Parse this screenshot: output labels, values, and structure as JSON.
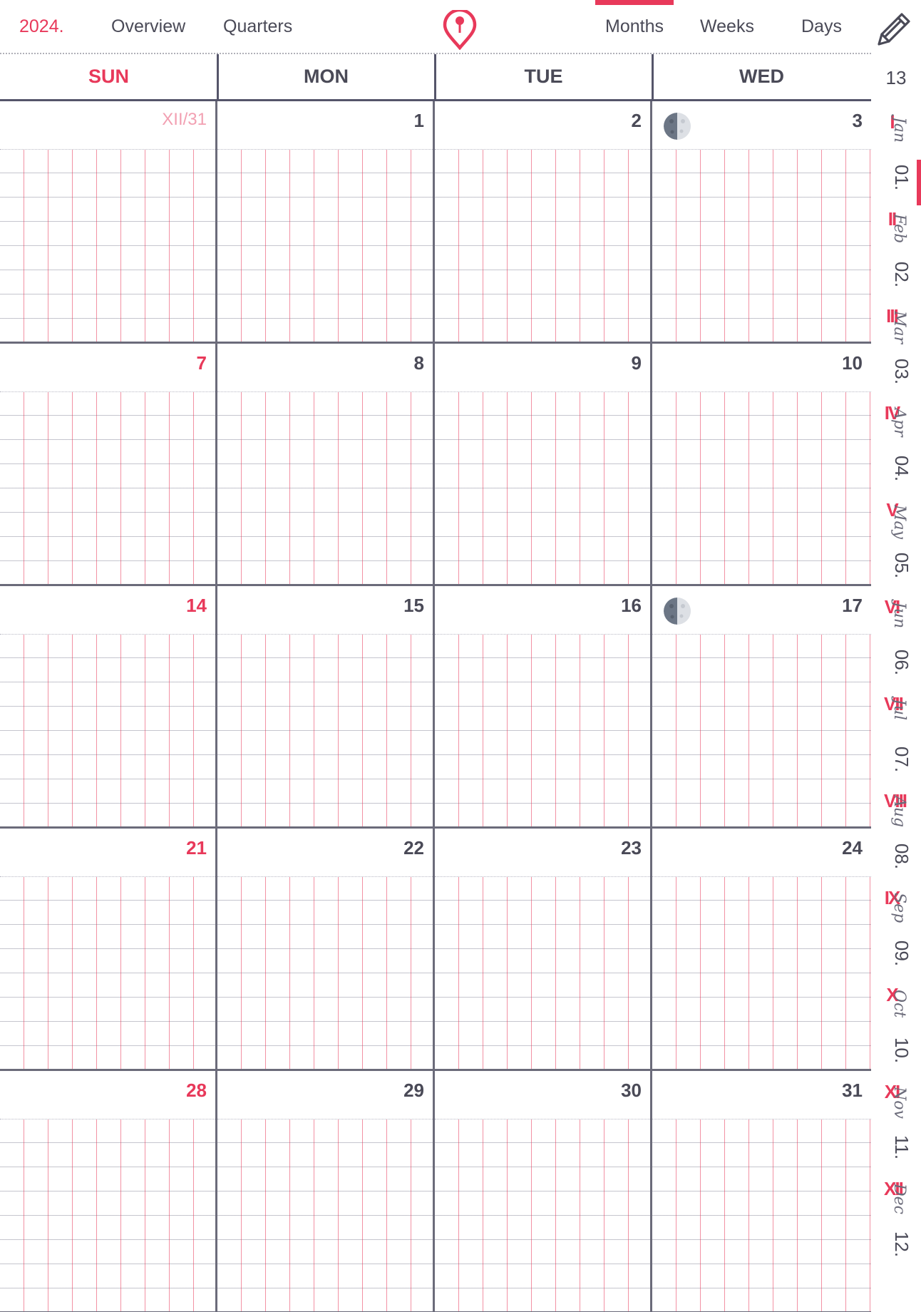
{
  "nav": {
    "year": "2024.",
    "overview": "Overview",
    "quarters": "Quarters",
    "months": "Months",
    "weeks": "Weeks",
    "days": "Days",
    "active_tab": "Months",
    "pin_icon": "location-pin-icon",
    "edit_icon": "pencil-icon"
  },
  "colors": {
    "accent": "#e8395a",
    "text": "#4a4a57",
    "grid": "#55556a"
  },
  "calendar": {
    "day_headers": [
      "SUN",
      "MON",
      "TUE",
      "WED"
    ],
    "weeks": [
      {
        "days": [
          {
            "label": "XII/31",
            "style": "prev"
          },
          {
            "label": "1"
          },
          {
            "label": "2"
          },
          {
            "label": "3",
            "moon": "last-quarter"
          }
        ]
      },
      {
        "days": [
          {
            "label": "7",
            "style": "sunday"
          },
          {
            "label": "8"
          },
          {
            "label": "9"
          },
          {
            "label": "10"
          }
        ]
      },
      {
        "days": [
          {
            "label": "14",
            "style": "sunday"
          },
          {
            "label": "15"
          },
          {
            "label": "16"
          },
          {
            "label": "17",
            "moon": "first-quarter"
          }
        ]
      },
      {
        "days": [
          {
            "label": "21",
            "style": "sunday"
          },
          {
            "label": "22"
          },
          {
            "label": "23"
          },
          {
            "label": "24"
          }
        ]
      },
      {
        "days": [
          {
            "label": "28",
            "style": "sunday"
          },
          {
            "label": "29"
          },
          {
            "label": "30"
          },
          {
            "label": "31"
          }
        ]
      }
    ]
  },
  "sidebar": {
    "week_number": "13",
    "active_month": "01.",
    "months": [
      {
        "roman": "I",
        "script": "Jan",
        "num": "01."
      },
      {
        "roman": "II",
        "script": "Feb",
        "num": "02."
      },
      {
        "roman": "III",
        "script": "Mar",
        "num": "03."
      },
      {
        "roman": "IV",
        "script": "Apr",
        "num": "04."
      },
      {
        "roman": "V",
        "script": "May",
        "num": "05."
      },
      {
        "roman": "VI",
        "script": "Jun",
        "num": "06."
      },
      {
        "roman": "VII",
        "script": "Jul",
        "num": "07."
      },
      {
        "roman": "VIII",
        "script": "Aug",
        "num": "08."
      },
      {
        "roman": "IX",
        "script": "Sep",
        "num": "09."
      },
      {
        "roman": "X",
        "script": "Oct",
        "num": "10."
      },
      {
        "roman": "XI",
        "script": "Nov",
        "num": "11."
      },
      {
        "roman": "XII",
        "script": "Dec",
        "num": "12."
      }
    ]
  }
}
